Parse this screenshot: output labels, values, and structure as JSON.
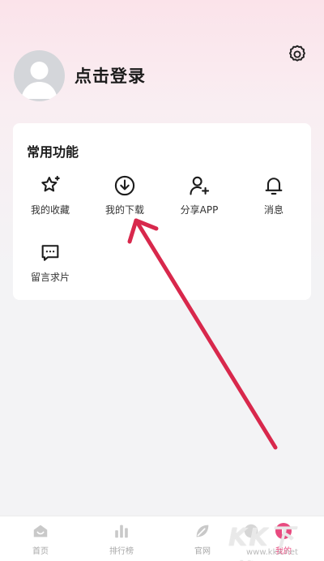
{
  "profile": {
    "login_text": "点击登录"
  },
  "common_functions": {
    "title": "常用功能",
    "items": [
      {
        "label": "我的收藏",
        "icon": "star-icon"
      },
      {
        "label": "我的下载",
        "icon": "download-icon"
      },
      {
        "label": "分享APP",
        "icon": "share-user-icon"
      },
      {
        "label": "消息",
        "icon": "bell-icon"
      },
      {
        "label": "留言求片",
        "icon": "message-icon"
      }
    ]
  },
  "tabbar": {
    "items": [
      {
        "label": "首页",
        "icon": "home-icon"
      },
      {
        "label": "排行榜",
        "icon": "rank-icon"
      },
      {
        "label": "官网",
        "icon": "leaf-icon"
      },
      {
        "label": "",
        "icon": "discover-icon"
      },
      {
        "label": "我的",
        "icon": "profile-icon"
      }
    ],
    "active_index": 4
  },
  "watermark": {
    "brand": "KK下载",
    "url": "www.kkx.net"
  },
  "colors": {
    "accent": "#e84a7f",
    "annotation_arrow": "#d8284c"
  }
}
